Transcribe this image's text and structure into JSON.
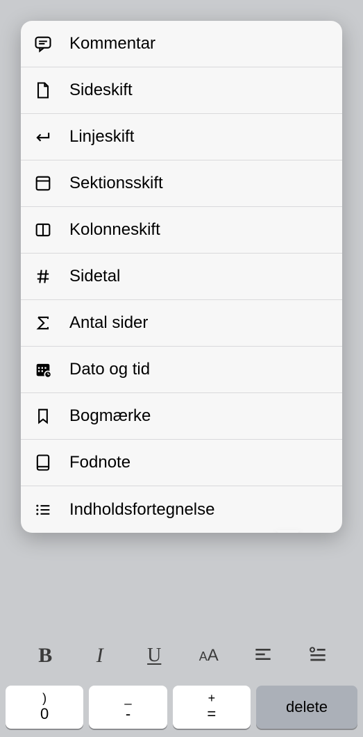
{
  "menu": {
    "items": [
      {
        "label": "Kommentar",
        "icon": "comment-icon"
      },
      {
        "label": "Sideskift",
        "icon": "page-break-icon"
      },
      {
        "label": "Linjeskift",
        "icon": "line-break-icon"
      },
      {
        "label": "Sektionsskift",
        "icon": "section-break-icon"
      },
      {
        "label": "Kolonneskift",
        "icon": "column-break-icon"
      },
      {
        "label": "Sidetal",
        "icon": "hash-icon"
      },
      {
        "label": "Antal sider",
        "icon": "sigma-icon"
      },
      {
        "label": "Dato og tid",
        "icon": "calendar-icon"
      },
      {
        "label": "Bogmærke",
        "icon": "bookmark-icon"
      },
      {
        "label": "Fodnote",
        "icon": "footnote-icon"
      },
      {
        "label": "Indholdsfortegnelse",
        "icon": "toc-icon"
      }
    ]
  },
  "format_bar": {
    "bold": "B",
    "italic": "I",
    "underline": "U",
    "fontsize_large": "A",
    "fontsize_small": "A"
  },
  "keyboard": {
    "keys": [
      {
        "top": ")",
        "bottom": "0"
      },
      {
        "top": "_",
        "bottom": "-"
      },
      {
        "top": "+",
        "bottom": "="
      }
    ],
    "delete": "delete"
  }
}
